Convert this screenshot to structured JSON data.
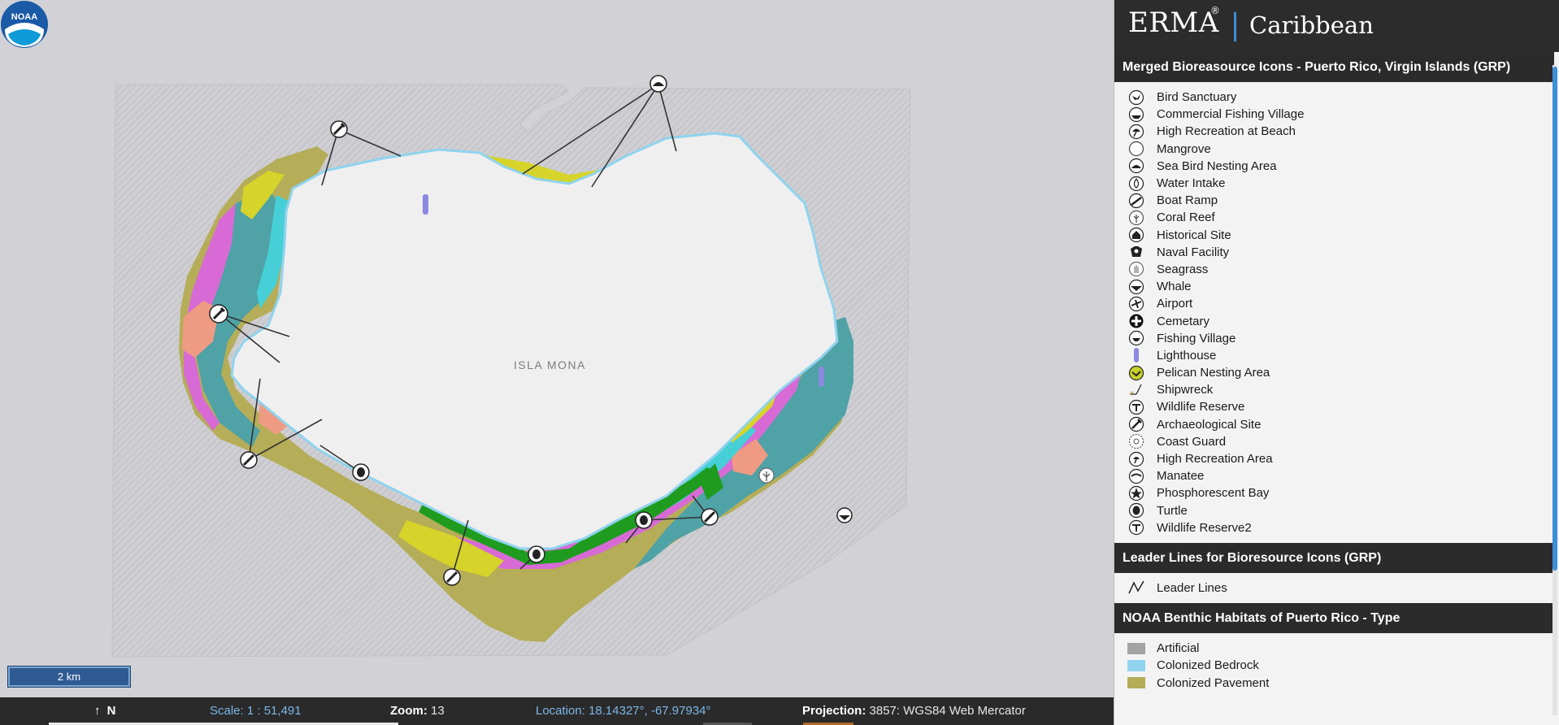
{
  "map": {
    "island_label": "ISLA MONA",
    "logo_text": "NOAA",
    "scale_bar": "2 km"
  },
  "status": {
    "north": "N",
    "scale_label": "Scale:",
    "scale_value": "1 : 51,491",
    "zoom_label": "Zoom:",
    "zoom_value": "13",
    "location_label": "Location:",
    "location_value": "18.14327°, -67.97934°",
    "projection_label": "Projection:",
    "projection_value": "3857: WGS84 Web Mercator"
  },
  "panel": {
    "brand": "ERMA",
    "registered": "®",
    "region": "Caribbean",
    "sections": [
      {
        "title": "Merged Bioreasource Icons - Puerto Rico, Virgin Islands (GRP)"
      },
      {
        "title": "Leader Lines for Bioresource Icons (GRP)"
      },
      {
        "title": "NOAA Benthic Habitats of Puerto Rico - Type"
      }
    ],
    "bio_items": [
      {
        "label": "Bird Sanctuary",
        "icon": "bird-icon"
      },
      {
        "label": "Commercial Fishing Village",
        "icon": "boat-icon"
      },
      {
        "label": "High Recreation at Beach",
        "icon": "beach-umbrella-icon"
      },
      {
        "label": "Mangrove",
        "icon": "mangrove-icon"
      },
      {
        "label": "Sea Bird Nesting Area",
        "icon": "nest-icon"
      },
      {
        "label": "Water Intake",
        "icon": "water-drop-icon"
      },
      {
        "label": "Boat Ramp",
        "icon": "boat-ramp-icon"
      },
      {
        "label": "Coral Reef",
        "icon": "coral-icon"
      },
      {
        "label": "Historical Site",
        "icon": "house-icon"
      },
      {
        "label": "Naval Facility",
        "icon": "naval-icon"
      },
      {
        "label": "Seagrass",
        "icon": "seagrass-icon"
      },
      {
        "label": "Whale",
        "icon": "whale-icon"
      },
      {
        "label": "Airport",
        "icon": "airplane-icon"
      },
      {
        "label": "Cemetary",
        "icon": "cross-icon"
      },
      {
        "label": "Fishing Village",
        "icon": "fishing-icon"
      },
      {
        "label": "Lighthouse",
        "icon": "lighthouse-icon"
      },
      {
        "label": "Pelican Nesting Area",
        "icon": "pelican-icon"
      },
      {
        "label": "Shipwreck",
        "icon": "shipwreck-icon"
      },
      {
        "label": "Wildlife Reserve",
        "icon": "wildlife-icon"
      },
      {
        "label": "Archaeological Site",
        "icon": "archaeology-icon"
      },
      {
        "label": "Coast Guard",
        "icon": "coast-guard-icon"
      },
      {
        "label": "High Recreation Area",
        "icon": "recreation-icon"
      },
      {
        "label": "Manatee",
        "icon": "manatee-icon"
      },
      {
        "label": "Phosphorescent Bay",
        "icon": "star-icon"
      },
      {
        "label": "Turtle",
        "icon": "turtle-icon"
      },
      {
        "label": "Wildlife Reserve2",
        "icon": "wildlife-icon"
      }
    ],
    "leader_items": [
      {
        "label": "Leader Lines",
        "icon": "leader-line-icon"
      }
    ],
    "benthic_items": [
      {
        "label": "Artificial",
        "color": "#a3a3a3"
      },
      {
        "label": "Colonized Bedrock",
        "color": "#8fd3ee"
      },
      {
        "label": "Colonized Pavement",
        "color": "#b5ad58"
      }
    ]
  },
  "colors": {
    "accent": "#3c8fd6",
    "land": "#efefef",
    "sea": "#d2d2d6",
    "magenta": "#d86ad6",
    "olive": "#b5ad58",
    "teal": "#4fa2a6",
    "cyan": "#46cfd6",
    "yellow": "#d6d32a",
    "green": "#1f9c1f",
    "salmon": "#ef9a82"
  }
}
